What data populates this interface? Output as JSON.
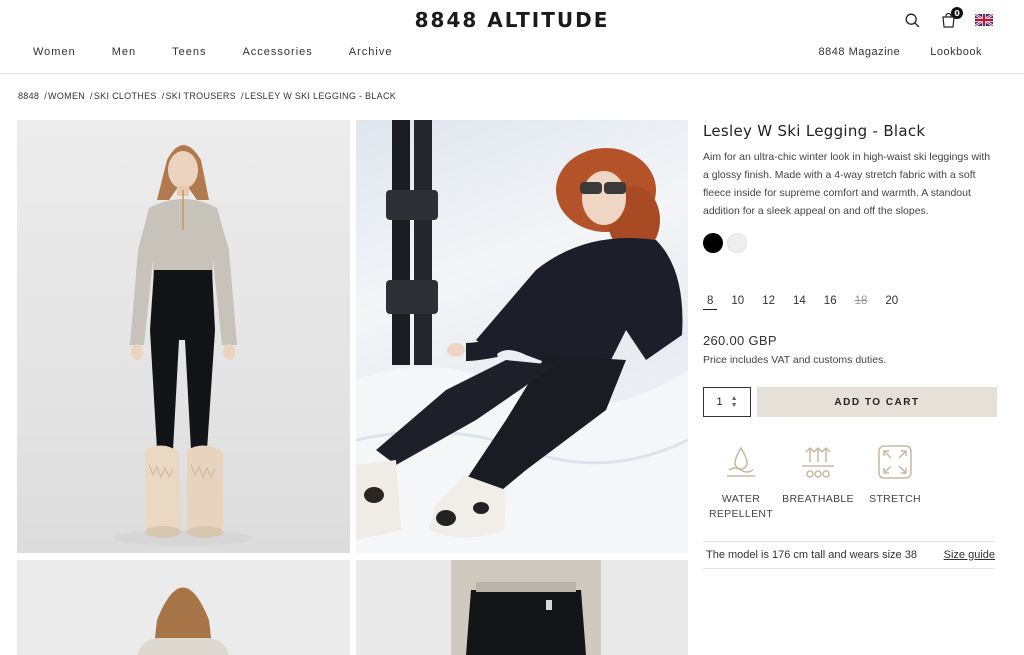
{
  "header": {
    "logo": "8848 ALTITUDE",
    "cart_count": "0",
    "nav_left": [
      "Women",
      "Men",
      "Teens",
      "Accessories",
      "Archive"
    ],
    "nav_right": [
      "8848 Magazine",
      "Lookbook"
    ]
  },
  "breadcrumb": [
    "8848",
    "WOMEN",
    "SKI CLOTHES",
    "SKI TROUSERS",
    "LESLEY W SKI LEGGING - BLACK"
  ],
  "product": {
    "title": "Lesley W Ski Legging - Black",
    "description": "Aim for an ultra-chic winter look in high-waist ski leggings with a glossy finish. Made with a 4-way stretch fabric with a soft fleece inside for supreme comfort and warmth. A standout addition for a sleek appeal on and off the slopes.",
    "colors": [
      "#000000",
      "#eeeeee"
    ],
    "sizes": [
      {
        "label": "8",
        "selected": true,
        "soldout": false
      },
      {
        "label": "10",
        "selected": false,
        "soldout": false
      },
      {
        "label": "12",
        "selected": false,
        "soldout": false
      },
      {
        "label": "14",
        "selected": false,
        "soldout": false
      },
      {
        "label": "16",
        "selected": false,
        "soldout": false
      },
      {
        "label": "18",
        "selected": false,
        "soldout": true
      },
      {
        "label": "20",
        "selected": false,
        "soldout": false
      }
    ],
    "price": "260.00 GBP",
    "vat_note": "Price includes VAT and customs duties.",
    "quantity": "1",
    "add_to_cart": "ADD TO CART",
    "features": [
      {
        "icon": "water-repellent-icon",
        "label": "WATER REPELLENT"
      },
      {
        "icon": "breathable-icon",
        "label": "BREATHABLE"
      },
      {
        "icon": "stretch-icon",
        "label": "STRETCH"
      }
    ],
    "model_info": "The model is 176 cm tall and wears size 38",
    "size_guide": "Size guide"
  },
  "theme": {
    "accent_button": "#e6e1d8",
    "text": "#222222"
  }
}
